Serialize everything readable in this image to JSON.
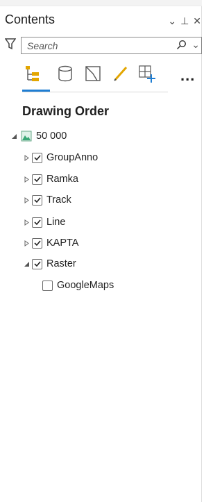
{
  "pane": {
    "title": "Contents",
    "window_icons": [
      "⌄",
      "⊥",
      "✕"
    ]
  },
  "search": {
    "placeholder": "Search"
  },
  "toolbar": {
    "tools": [
      "list-by-drawing-order-icon",
      "list-by-source-icon",
      "list-by-selection-icon",
      "list-by-editing-icon",
      "list-by-snapping-icon"
    ],
    "more_label": "..."
  },
  "drawing_order": {
    "heading": "Drawing Order",
    "map": {
      "label": "50 000",
      "expanded": true
    },
    "layers": [
      {
        "label": "GroupAnno",
        "checked": true,
        "expander": "collapsed"
      },
      {
        "label": "Ramka",
        "checked": true,
        "expander": "collapsed"
      },
      {
        "label": "Track",
        "checked": true,
        "expander": "collapsed"
      },
      {
        "label": "Line",
        "checked": true,
        "expander": "collapsed"
      },
      {
        "label": "KAPTA",
        "checked": true,
        "expander": "collapsed"
      },
      {
        "label": "Raster",
        "checked": true,
        "expander": "expanded"
      }
    ],
    "sublayers": [
      {
        "label": "GoogleMaps",
        "checked": false
      }
    ]
  },
  "colors": {
    "accent": "#1f7ed3",
    "map_icon": "#3aa776"
  }
}
